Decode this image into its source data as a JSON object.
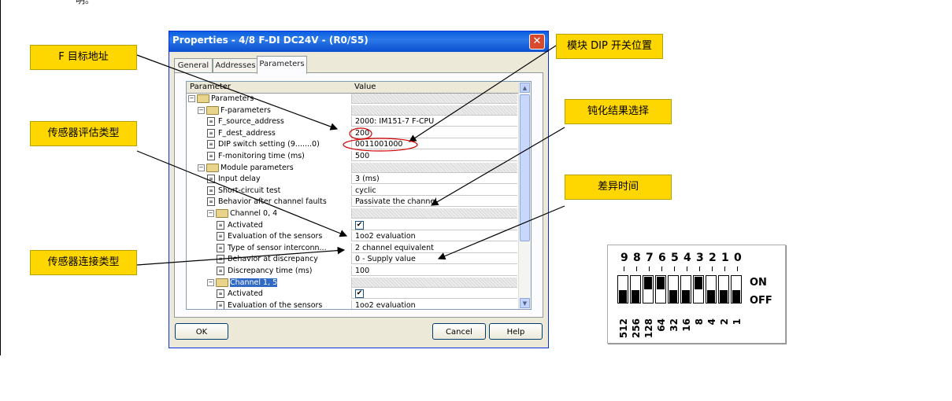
{
  "doc": {
    "fragment": "明。"
  },
  "window": {
    "title": "Properties - 4/8 F-DI DC24V - (R0/S5)",
    "close_glyph": "✕",
    "tabs": [
      "General",
      "Addresses",
      "Parameters"
    ],
    "active_tab": "Parameters",
    "col_param": "Parameter",
    "col_value": "Value",
    "rows": [
      {
        "label": "Parameters",
        "value": ""
      },
      {
        "label": "F-parameters",
        "value": ""
      },
      {
        "label": "F_source_address",
        "value": "2000: IM151-7 F-CPU"
      },
      {
        "label": "F_dest_address",
        "value": "200"
      },
      {
        "label": "DIP switch setting (9.......0)",
        "value": "0011001000"
      },
      {
        "label": "F-monitoring time (ms)",
        "value": "500"
      },
      {
        "label": "Module parameters",
        "value": ""
      },
      {
        "label": "Input delay",
        "value": "3 (ms)"
      },
      {
        "label": "Short-circuit test",
        "value": "cyclic"
      },
      {
        "label": "Behavior after channel faults",
        "value": "Passivate the channel"
      },
      {
        "label": "Channel 0, 4",
        "value": ""
      },
      {
        "label": "Activated",
        "value": "✔"
      },
      {
        "label": "Evaluation of the sensors",
        "value": "1oo2 evaluation"
      },
      {
        "label": "Type of sensor interconn...",
        "value": "2 channel equivalent"
      },
      {
        "label": "Behavior at discrepancy",
        "value": "0 - Supply value"
      },
      {
        "label": "Discrepancy time (ms)",
        "value": "100"
      },
      {
        "label": "Channel 1, 5",
        "value": ""
      },
      {
        "label": "Activated",
        "value": "✔"
      },
      {
        "label": "Evaluation of the sensors",
        "value": "1oo2 evaluation"
      }
    ],
    "buttons": {
      "ok": "OK",
      "cancel": "Cancel",
      "help": "Help"
    }
  },
  "callouts": {
    "f_target_address": "F 目标地址",
    "sensor_eval_type": "传感器评估类型",
    "sensor_conn_type": "传感器连接类型",
    "dip_position": "模块 DIP 开关位置",
    "passivation": "钝化结果选择",
    "discrepancy_time": "差异时间"
  },
  "dip": {
    "positions": [
      "9",
      "8",
      "7",
      "6",
      "5",
      "4",
      "3",
      "2",
      "1",
      "0"
    ],
    "weights": [
      "512",
      "256",
      "128",
      "64",
      "32",
      "16",
      "8",
      "4",
      "2",
      "1"
    ],
    "settings": [
      "off",
      "off",
      "on",
      "on",
      "off",
      "off",
      "on",
      "off",
      "off",
      "off"
    ],
    "on_label": "ON",
    "off_label": "OFF"
  },
  "colors": {
    "callout": "#ffd700",
    "title_bar": "#0a5fe0",
    "highlight_ellipse": "#d00000",
    "selection": "#316ac5"
  }
}
